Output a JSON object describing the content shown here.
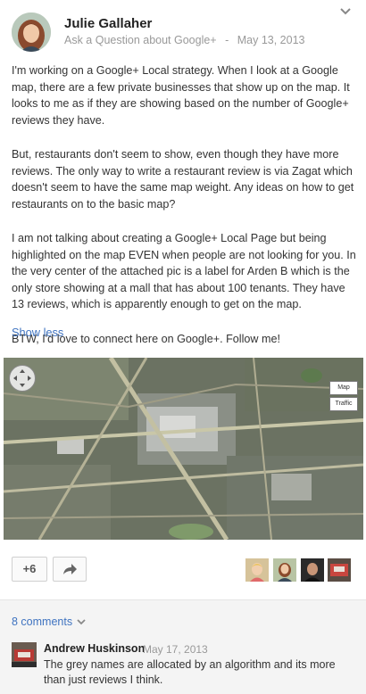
{
  "post": {
    "author": "Julie Gallaher",
    "community": "Ask a Question about Google+",
    "separator": "-",
    "date": "May 13, 2013",
    "paragraphs": [
      "I'm working on a Google+ Local strategy. When I look at a Google map, there are a few private businesses that show up on the map. It looks to me as if they are showing based on the number of Google+ reviews they have.",
      "But, restaurants don't seem to show, even though they have more reviews.  The only way to write a restaurant review is via Zagat which doesn't seem to have the same map weight.  Any ideas on how to get restaurants on to the basic map?",
      "I am not talking about creating a Google+ Local Page but being highlighted on the map EVEN when people are not looking for you. In the very center of the attached pic is a label for Arden B which is the only store showing at a mall that has about 100 tenants.  They have 13 reviews, which is apparently enough to get on the map.",
      "BTW, I'd love to connect here on Google+. Follow me!"
    ],
    "show_less": "Show less"
  },
  "map": {
    "map_button": "Map",
    "traffic_button": "Traffic"
  },
  "actions": {
    "plus_one": "+6"
  },
  "comments": {
    "count_label": "8 comments",
    "items": [
      {
        "author": "Andrew Huskinson",
        "date": "May 17, 2013",
        "text": "The grey names are allocated by an algorithm and its more than just reviews I think."
      }
    ]
  },
  "colors": {
    "link": "#3f73c0",
    "meta": "#999999",
    "comments_bg": "#f4f4f4"
  },
  "icons": {
    "post_menu": "chevron-down-icon",
    "share": "share-arrow-icon",
    "comments_toggle": "chevron-down-icon",
    "map_pan": "pan-control-icon"
  }
}
